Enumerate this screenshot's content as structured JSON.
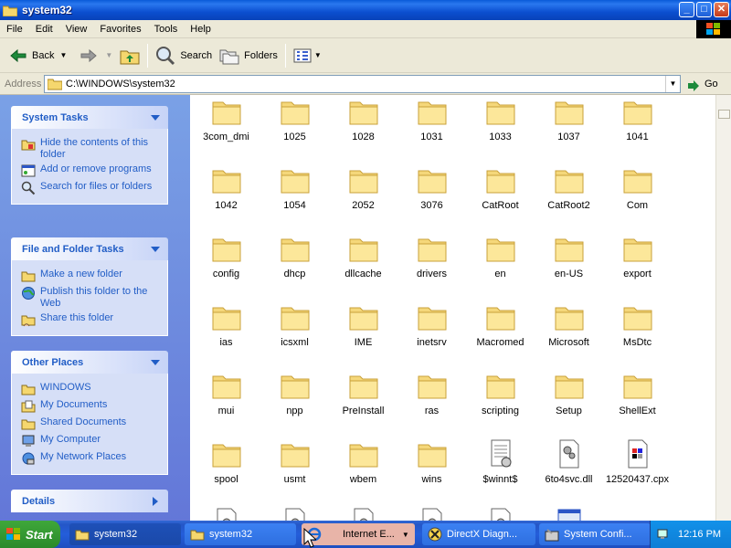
{
  "window": {
    "title": "system32"
  },
  "menu": [
    "File",
    "Edit",
    "View",
    "Favorites",
    "Tools",
    "Help"
  ],
  "toolbar": {
    "back": "Back",
    "search": "Search",
    "folders": "Folders"
  },
  "address": {
    "label": "Address",
    "value": "C:\\WINDOWS\\system32",
    "go": "Go"
  },
  "left": {
    "system_tasks": {
      "title": "System Tasks",
      "items": [
        "Hide the contents of this folder",
        "Add or remove programs",
        "Search for files or folders"
      ]
    },
    "file_tasks": {
      "title": "File and Folder Tasks",
      "items": [
        "Make a new folder",
        "Publish this folder to the Web",
        "Share this folder"
      ]
    },
    "other_places": {
      "title": "Other Places",
      "items": [
        "WINDOWS",
        "My Documents",
        "Shared Documents",
        "My Computer",
        "My Network Places"
      ]
    },
    "details": {
      "title": "Details"
    }
  },
  "files": [
    {
      "name": "3com_dmi",
      "type": "folder"
    },
    {
      "name": "1025",
      "type": "folder"
    },
    {
      "name": "1028",
      "type": "folder"
    },
    {
      "name": "1031",
      "type": "folder"
    },
    {
      "name": "1033",
      "type": "folder"
    },
    {
      "name": "1037",
      "type": "folder"
    },
    {
      "name": "1041",
      "type": "folder"
    },
    {
      "name": "1042",
      "type": "folder"
    },
    {
      "name": "1054",
      "type": "folder"
    },
    {
      "name": "2052",
      "type": "folder"
    },
    {
      "name": "3076",
      "type": "folder"
    },
    {
      "name": "CatRoot",
      "type": "folder"
    },
    {
      "name": "CatRoot2",
      "type": "folder"
    },
    {
      "name": "Com",
      "type": "folder"
    },
    {
      "name": "config",
      "type": "folder"
    },
    {
      "name": "dhcp",
      "type": "folder"
    },
    {
      "name": "dllcache",
      "type": "folder"
    },
    {
      "name": "drivers",
      "type": "folder"
    },
    {
      "name": "en",
      "type": "folder"
    },
    {
      "name": "en-US",
      "type": "folder"
    },
    {
      "name": "export",
      "type": "folder"
    },
    {
      "name": "ias",
      "type": "folder"
    },
    {
      "name": "icsxml",
      "type": "folder"
    },
    {
      "name": "IME",
      "type": "folder"
    },
    {
      "name": "inetsrv",
      "type": "folder"
    },
    {
      "name": "Macromed",
      "type": "folder"
    },
    {
      "name": "Microsoft",
      "type": "folder"
    },
    {
      "name": "MsDtc",
      "type": "folder"
    },
    {
      "name": "mui",
      "type": "folder"
    },
    {
      "name": "npp",
      "type": "folder"
    },
    {
      "name": "PreInstall",
      "type": "folder"
    },
    {
      "name": "ras",
      "type": "folder"
    },
    {
      "name": "scripting",
      "type": "folder"
    },
    {
      "name": "Setup",
      "type": "folder"
    },
    {
      "name": "ShellExt",
      "type": "folder"
    },
    {
      "name": "spool",
      "type": "folder"
    },
    {
      "name": "usmt",
      "type": "folder"
    },
    {
      "name": "wbem",
      "type": "folder"
    },
    {
      "name": "wins",
      "type": "folder"
    },
    {
      "name": "$winnt$",
      "type": "ini"
    },
    {
      "name": "6to4svc.dll",
      "type": "dll"
    },
    {
      "name": "12520437.cpx",
      "type": "cpx"
    },
    {
      "name": "",
      "type": "file"
    },
    {
      "name": "",
      "type": "file"
    },
    {
      "name": "",
      "type": "file"
    },
    {
      "name": "",
      "type": "file"
    },
    {
      "name": "",
      "type": "file"
    },
    {
      "name": "",
      "type": "app"
    }
  ],
  "taskbar": {
    "start": "Start",
    "tasks": [
      "system32",
      "system32",
      "Internet E...",
      "DirectX Diagn...",
      "System Confi..."
    ],
    "clock": "12:16 PM"
  }
}
